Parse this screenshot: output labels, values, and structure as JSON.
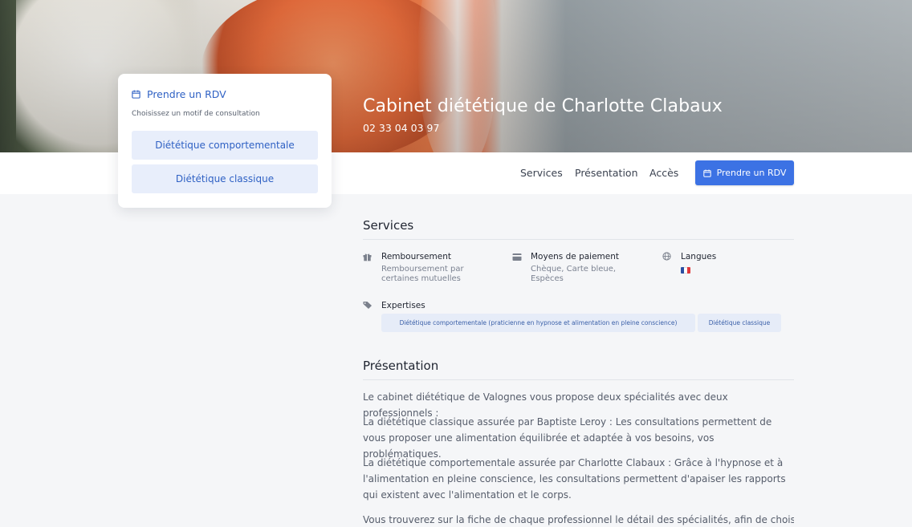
{
  "hero": {
    "title": "Cabinet diététique de Charlotte Clabaux",
    "phone": "02 33 04 03 97"
  },
  "booking_card": {
    "heading": "Prendre un RDV",
    "subtitle": "Choisissez un motif de consultation",
    "motifs": [
      "Diététique comportementale",
      "Diététique classique"
    ]
  },
  "nav": {
    "links": [
      "Services",
      "Présentation",
      "Accès"
    ],
    "cta": "Prendre un RDV"
  },
  "services": {
    "title": "Services",
    "items": [
      {
        "icon": "gift-icon",
        "title": "Remboursement",
        "text_lines": [
          "Remboursement par",
          "certaines mutuelles"
        ]
      },
      {
        "icon": "credit-card-icon",
        "title": "Moyens de paiement",
        "text_lines": [
          "Chèque, Carte bleue,",
          "Espèces"
        ]
      },
      {
        "icon": "globe-icon",
        "title": "Langues",
        "flag": "french-flag"
      }
    ],
    "expertises": {
      "icon": "tags-icon",
      "title": "Expertises",
      "tags": [
        "Diététique comportementale (praticienne en hypnose et alimentation en pleine conscience)",
        "Diététique classique"
      ]
    }
  },
  "presentation": {
    "title": "Présentation",
    "paragraphs": [
      "Le cabinet diététique de Valognes vous propose deux spécialités avec deux professionnels :",
      "La diététique classique assurée par Baptiste Leroy : Les consultations permettent de vous proposer une alimentation équilibrée et adaptée à vos besoins, vos problématiques.",
      "La diététique comportementale assurée par Charlotte Clabaux : Grâce à l'hypnose et à l'alimentation en pleine conscience, les consultations permettent d'apaiser les rapports qui existent avec l'alimentation et le corps.",
      "Vous trouverez sur la fiche de chaque professionnel le détail des spécialités, afin de choisir la"
    ]
  },
  "colors": {
    "primary": "#3c72e4",
    "link_blue": "#2f61c4",
    "tag_bg": "#e6ecf8"
  }
}
